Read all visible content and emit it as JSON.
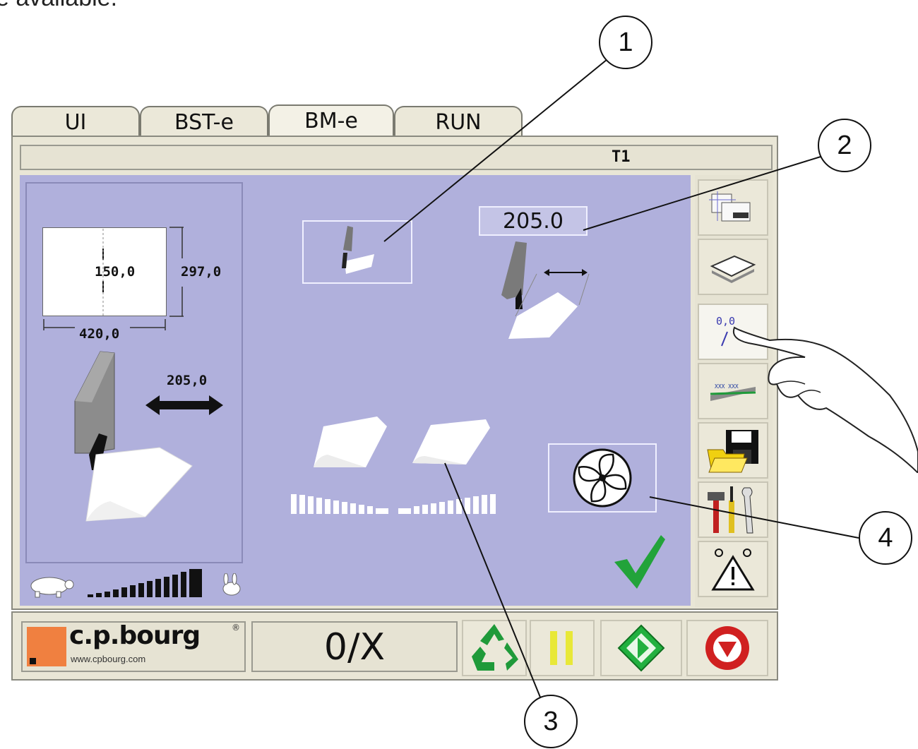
{
  "fragment_text": "e available.",
  "tabs": [
    "UI",
    "BST-e",
    "BM-e",
    "RUN"
  ],
  "active_tab": "BM-e",
  "title_bar": {
    "label": "T1"
  },
  "left_panel": {
    "fold_position": "150,0",
    "paper_height": "297,0",
    "paper_width": "420,0",
    "stop_distance": "205,0"
  },
  "top_value": "205.0",
  "counter": "0/X",
  "logo": {
    "brand": "c.p.bourg",
    "url": "www.cpbourg.com",
    "mark": "®"
  },
  "toolbar_value": "0,0",
  "toolbar_icons": [
    "layout-icon",
    "sheet-icon",
    "value-adjust-icon",
    "ruler-icon",
    "save-folder-icon",
    "tools-icon",
    "warning-icon"
  ],
  "callouts": [
    "1",
    "2",
    "3",
    "4"
  ],
  "colors": {
    "panel": "#b0b0dc",
    "frame": "#e9e6d6",
    "accent_green": "#22a33a",
    "stop_red": "#d02020",
    "pause_yellow": "#e8e838",
    "logo_orange": "#f08040"
  }
}
